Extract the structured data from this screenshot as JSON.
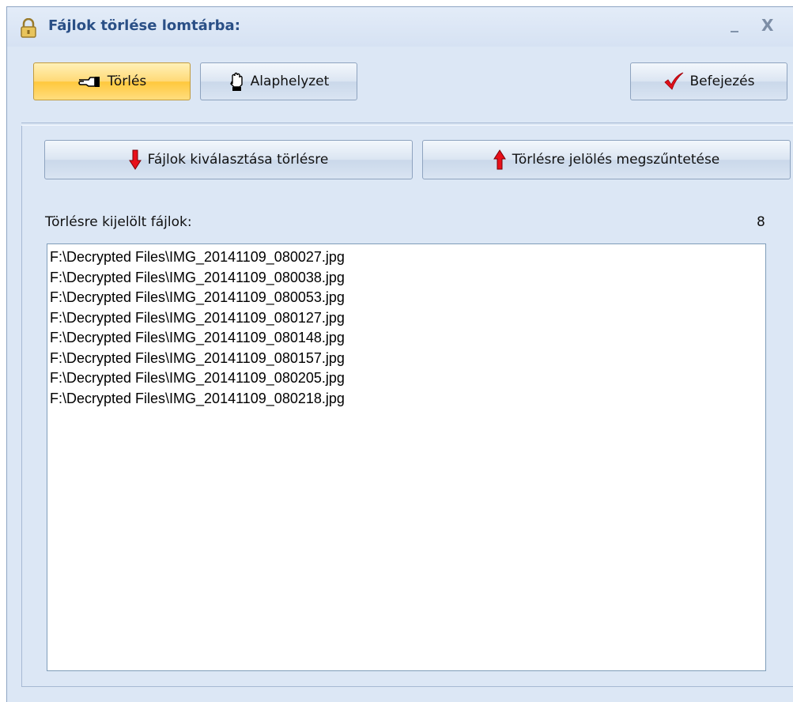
{
  "window": {
    "title": "Fájlok törlése lomtárba:",
    "minimize_label": "_",
    "close_label": "X"
  },
  "toolbar": {
    "delete_label": "Törlés",
    "reset_label": "Alaphelyzet",
    "finish_label": "Befejezés"
  },
  "actions": {
    "select_label": "Fájlok kiválasztása törlésre",
    "unselect_label": "Törlésre jelölés megszűntetése"
  },
  "list": {
    "label": "Törlésre kijelölt fájlok:",
    "count": "8",
    "items": [
      "F:\\Decrypted Files\\IMG_20141109_080027.jpg",
      "F:\\Decrypted Files\\IMG_20141109_080038.jpg",
      "F:\\Decrypted Files\\IMG_20141109_080053.jpg",
      "F:\\Decrypted Files\\IMG_20141109_080127.jpg",
      "F:\\Decrypted Files\\IMG_20141109_080148.jpg",
      "F:\\Decrypted Files\\IMG_20141109_080157.jpg",
      "F:\\Decrypted Files\\IMG_20141109_080205.jpg",
      "F:\\Decrypted Files\\IMG_20141109_080218.jpg"
    ]
  },
  "icons": {
    "title": "padlock-icon",
    "delete": "pointing-hand-icon",
    "reset": "raised-hand-icon",
    "finish": "checkmark-icon",
    "select": "arrow-down-icon",
    "unselect": "arrow-up-icon"
  },
  "colors": {
    "window_bg": "#dce7f5",
    "title_text": "#2a4f86",
    "active_button": "#ffd976",
    "arrow_red": "#e8101a",
    "check_red": "#e0101a"
  }
}
